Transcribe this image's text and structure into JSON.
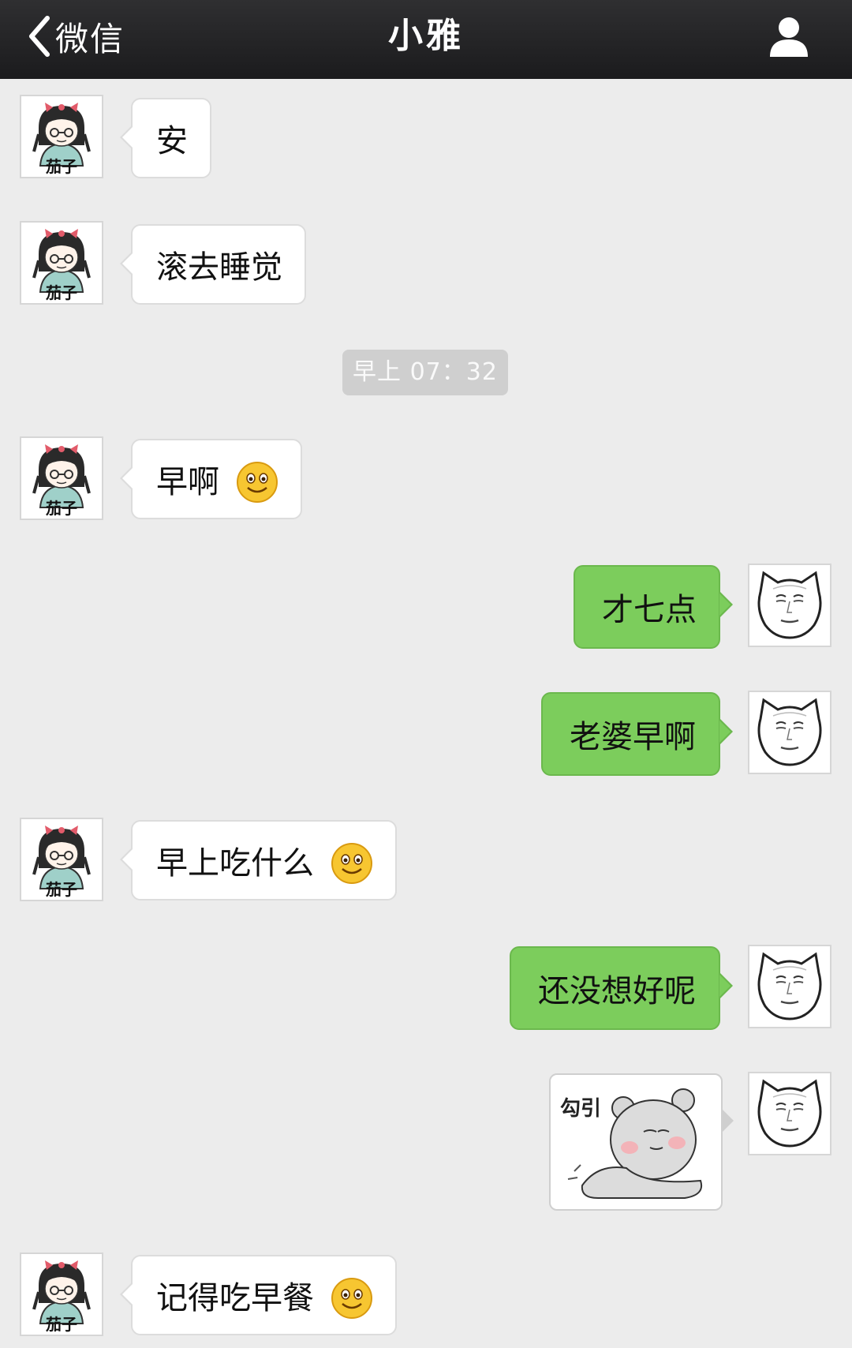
{
  "navbar": {
    "back_label": "微信",
    "title": "小雅"
  },
  "contact": {
    "avatar_caption": "茄子"
  },
  "timestamp": "早上 07：32",
  "messages": [
    {
      "sender": "contact",
      "text": "安"
    },
    {
      "sender": "contact",
      "text": "滚去睡觉"
    },
    {
      "sender": "contact",
      "text": "早啊",
      "emoji": "smile-emoji"
    },
    {
      "sender": "me",
      "text": "才七点"
    },
    {
      "sender": "me",
      "text": "老婆早啊"
    },
    {
      "sender": "contact",
      "text": "早上吃什么",
      "emoji": "smile-emoji"
    },
    {
      "sender": "me",
      "text": "还没想好呢"
    },
    {
      "sender": "me",
      "type": "sticker",
      "caption": "勾引"
    },
    {
      "sender": "contact",
      "text": "记得吃早餐",
      "emoji": "smile-emoji"
    }
  ],
  "colors": {
    "background": "#ececec",
    "navbar": "#1b1b1d",
    "incoming_bubble": "#ffffff",
    "outgoing_bubble": "#7ccd5c"
  }
}
